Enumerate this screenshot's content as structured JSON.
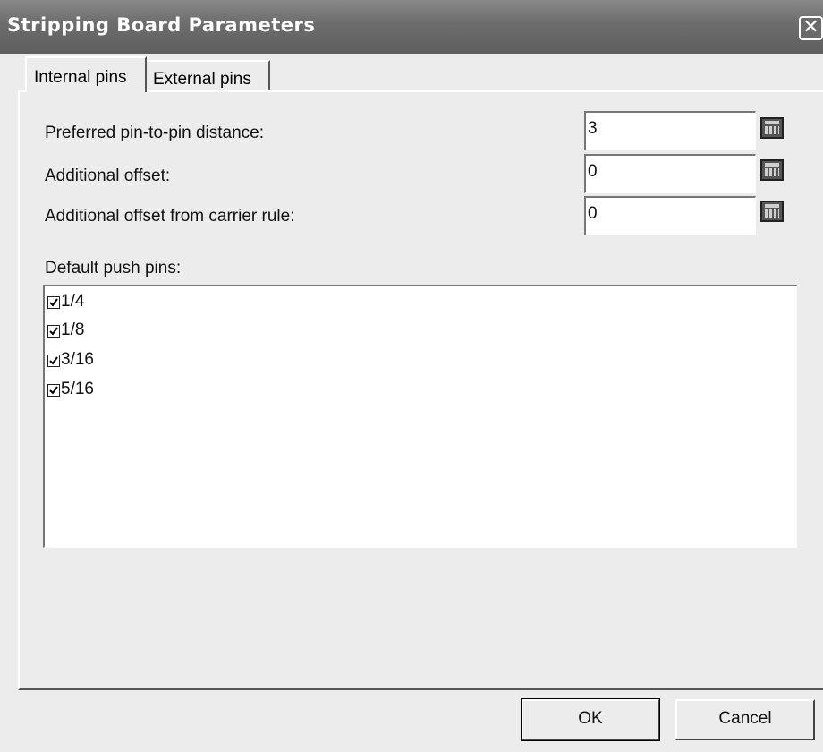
{
  "window": {
    "title": "Stripping Board Parameters",
    "close_glyph": "✕"
  },
  "tabs": [
    {
      "label": "Internal pins",
      "active": true
    },
    {
      "label": "External pins",
      "active": false
    }
  ],
  "fields": {
    "pin_distance": {
      "label": "Preferred pin-to-pin distance:",
      "value": "3"
    },
    "additional_offset": {
      "label": "Additional offset:",
      "value": "0"
    },
    "carrier_offset": {
      "label": "Additional offset from carrier rule:",
      "value": "0"
    }
  },
  "push_pins": {
    "label": "Default push pins:",
    "items": [
      {
        "label": "1/4",
        "checked": true
      },
      {
        "label": "1/8",
        "checked": true
      },
      {
        "label": "3/16",
        "checked": true
      },
      {
        "label": "5/16",
        "checked": true
      }
    ]
  },
  "buttons": {
    "ok": "OK",
    "cancel": "Cancel"
  },
  "icons": {
    "calculator": "calculator-icon",
    "close": "close-icon",
    "checkbox": "checkbox-checked-icon"
  }
}
